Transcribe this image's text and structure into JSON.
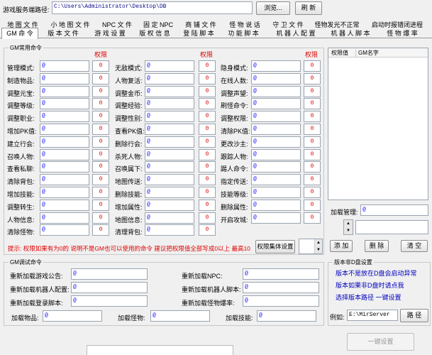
{
  "path_label": "游戏服务端路径:",
  "path_value": "C:\\Users\\Administrator\\Desktop\\DB",
  "browse_label": "浏览...",
  "refresh_label": "刷 新",
  "tabs_row1": [
    "地 图 文 件",
    "小 地 图 文 件",
    "NPC 文 件",
    "固 定 NPC",
    "商 铺 文 件",
    "怪 物 说 话",
    "守 卫 文 件",
    "怪物发光不正常",
    "启动时报错闭进程"
  ],
  "tabs_row2": [
    "GM 命 令",
    "版 本 文 件",
    "游 戏 设 置",
    "版 权 信 息",
    "登 陆 脚 本",
    "功 能 脚 本",
    "机 器 人 配 置",
    "机 器 人 脚 本",
    "怪 物 爆 率"
  ],
  "gm_group_title": "GM常用命令",
  "perm_header": "权限",
  "gm_col1": [
    {
      "label": "管理模式:",
      "value": "@",
      "perm": "0"
    },
    {
      "label": "制造物品:",
      "value": "@",
      "perm": "0"
    },
    {
      "label": "调整元宝:",
      "value": "@",
      "perm": "0"
    },
    {
      "label": "调整等级:",
      "value": "@",
      "perm": "0"
    },
    {
      "label": "调整职业:",
      "value": "@",
      "perm": "0"
    },
    {
      "label": "增加PK值:",
      "value": "@",
      "perm": "0"
    },
    {
      "label": "建立行会:",
      "value": "@",
      "perm": "0"
    },
    {
      "label": "召唤人物:",
      "value": "@",
      "perm": "0"
    },
    {
      "label": "查看私聊:",
      "value": "@",
      "perm": "0"
    },
    {
      "label": "清除背包:",
      "value": "@",
      "perm": "0"
    },
    {
      "label": "增加技能:",
      "value": "@",
      "perm": "0"
    },
    {
      "label": "调整转生:",
      "value": "@",
      "perm": "0"
    },
    {
      "label": "人物信息:",
      "value": "@",
      "perm": "0"
    },
    {
      "label": "清除怪物:",
      "value": "@",
      "perm": "0"
    }
  ],
  "gm_col2": [
    {
      "label": "无敌模式:",
      "value": "@",
      "perm": "0"
    },
    {
      "label": "人物复活:",
      "value": "@",
      "perm": "0"
    },
    {
      "label": "调整金币:",
      "value": "@",
      "perm": "0"
    },
    {
      "label": "调整经验:",
      "value": "@",
      "perm": "0"
    },
    {
      "label": "调整性别:",
      "value": "@",
      "perm": "0"
    },
    {
      "label": "查看PK值:",
      "value": "@",
      "perm": "0"
    },
    {
      "label": "删除行会:",
      "value": "@",
      "perm": "0"
    },
    {
      "label": "杀死人物:",
      "value": "@",
      "perm": "0"
    },
    {
      "label": "召唤属下:",
      "value": "@",
      "perm": "0"
    },
    {
      "label": "地图传送:",
      "value": "@",
      "perm": "0"
    },
    {
      "label": "删除技能:",
      "value": "@",
      "perm": "0"
    },
    {
      "label": "增加属性:",
      "value": "@",
      "perm": "0"
    },
    {
      "label": "地图信息:",
      "value": "@",
      "perm": "0"
    },
    {
      "label": "清理背包:",
      "value": "@",
      "perm": "0"
    }
  ],
  "gm_col3": [
    {
      "label": "隐身模式:",
      "value": "@",
      "perm": "0"
    },
    {
      "label": "在线人数:",
      "value": "@",
      "perm": "0"
    },
    {
      "label": "调整声望:",
      "value": "@",
      "perm": "0"
    },
    {
      "label": "刷怪命令:",
      "value": "@",
      "perm": "0"
    },
    {
      "label": "调整权限:",
      "value": "@",
      "perm": "0"
    },
    {
      "label": "清除PK值:",
      "value": "@",
      "perm": "0"
    },
    {
      "label": "更改沙主:",
      "value": "@",
      "perm": "0"
    },
    {
      "label": "跟踪人物:",
      "value": "@",
      "perm": "0"
    },
    {
      "label": "踢人命令:",
      "value": "@",
      "perm": "0"
    },
    {
      "label": "指定传送:",
      "value": "@",
      "perm": "0"
    },
    {
      "label": "技能等级:",
      "value": "@",
      "perm": "0"
    },
    {
      "label": "删除属性:",
      "value": "@",
      "perm": "0"
    },
    {
      "label": "开启攻城:",
      "value": "@",
      "perm": "0"
    }
  ],
  "hint_text": "提示: 权限如果有为0的 说明不是GM也可以使用的命令 建议把权限值全部写成0以上 最高10",
  "perm_set_label": "权限集体设置",
  "list_col1": "权限值",
  "list_col2": "GM名字",
  "load_mgmt_label": "加载管理:",
  "load_mgmt_value": "@",
  "add_label": "添 加",
  "delete_label": "删 除",
  "clear_label": "清 空",
  "debug_group_title": "GM调试命令",
  "debug_rows": [
    {
      "label": "重新加载游戏公告:",
      "value": "@"
    },
    {
      "label": "重新加载NPC:",
      "value": "@"
    },
    {
      "label": "重新加载机器人配置:",
      "value": "@"
    },
    {
      "label": "重新加载机器人脚本:",
      "value": "@"
    },
    {
      "label": "重新加载登录脚本:",
      "value": "@"
    },
    {
      "label": "重新加载怪物爆率:",
      "value": "@"
    }
  ],
  "load_items": [
    {
      "label": "加载物品:",
      "value": "@"
    },
    {
      "label": "加载怪物:",
      "value": "@"
    },
    {
      "label": "加载技能:",
      "value": "@"
    }
  ],
  "version_group_title": "版本非D盘设置",
  "version_line1": "版本不是放在D盘会启动异常",
  "version_line2": "版本如果非D盘时请点我",
  "version_line3": "选择版本路径 一键设置",
  "example_label": "例如:",
  "example_value": "E:\\MirServer",
  "path_btn_label": "路 径",
  "onekey_label": "一键设置"
}
